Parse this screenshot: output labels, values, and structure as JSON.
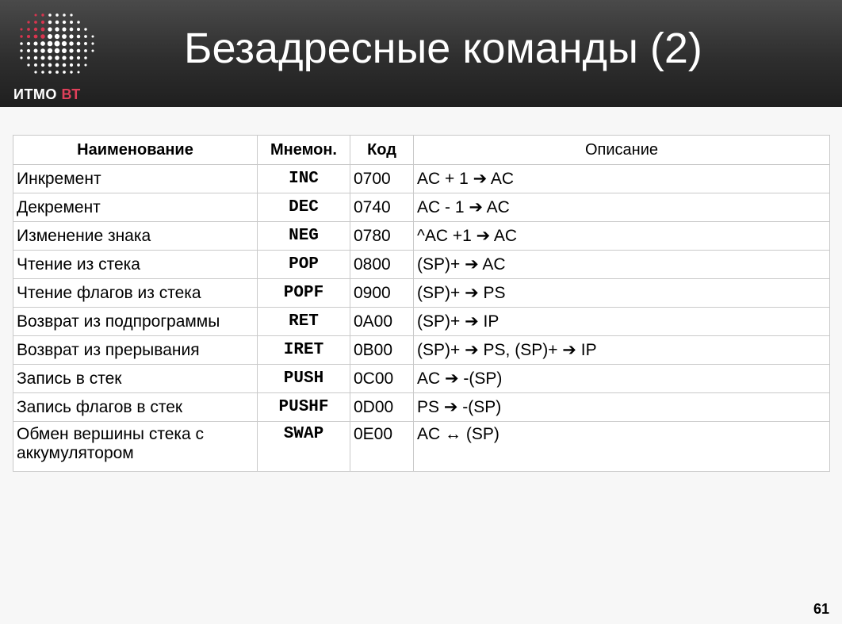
{
  "logo": {
    "text_main": "ИТМО",
    "text_accent": "ВТ",
    "accent_color": "#e0405a"
  },
  "slide": {
    "title": "Безадресные команды (2)",
    "page_number": "61"
  },
  "table": {
    "headers": {
      "name": "Наименование",
      "mnemonic": "Мнемон.",
      "code": "Код",
      "description": "Описание"
    },
    "rows": [
      {
        "name": "Инкремент",
        "mnemonic": "INC",
        "code": "0700",
        "description": "AC + 1 ➔ AC"
      },
      {
        "name": "Декремент",
        "mnemonic": "DEC",
        "code": "0740",
        "description": "AC - 1 ➔ AC"
      },
      {
        "name": "Изменение знака",
        "mnemonic": "NEG",
        "code": "0780",
        "description": "^AC +1 ➔ AC"
      },
      {
        "name": "Чтение из стека",
        "mnemonic": "POP",
        "code": "0800",
        "description": "(SP)+ ➔ AC"
      },
      {
        "name": "Чтение флагов из стека",
        "mnemonic": "POPF",
        "code": "0900",
        "description": "(SP)+ ➔ PS"
      },
      {
        "name": "Возврат из подпрограммы",
        "mnemonic": "RET",
        "code": "0A00",
        "description": "(SP)+ ➔ IP"
      },
      {
        "name": "Возврат из прерывания",
        "mnemonic": "IRET",
        "code": "0B00",
        "description": "(SP)+ ➔ PS, (SP)+ ➔ IP"
      },
      {
        "name": "Запись в стек",
        "mnemonic": "PUSH",
        "code": "0C00",
        "description": "AC ➔  -(SP)"
      },
      {
        "name": "Запись флагов в стек",
        "mnemonic": "PUSHF",
        "code": "0D00",
        "description": "PS ➔  -(SP)"
      },
      {
        "name": "Обмен вершины стека с аккумулятором",
        "mnemonic": "SWAP",
        "code": "0E00",
        "description": "AC ↔  (SP)"
      }
    ]
  }
}
